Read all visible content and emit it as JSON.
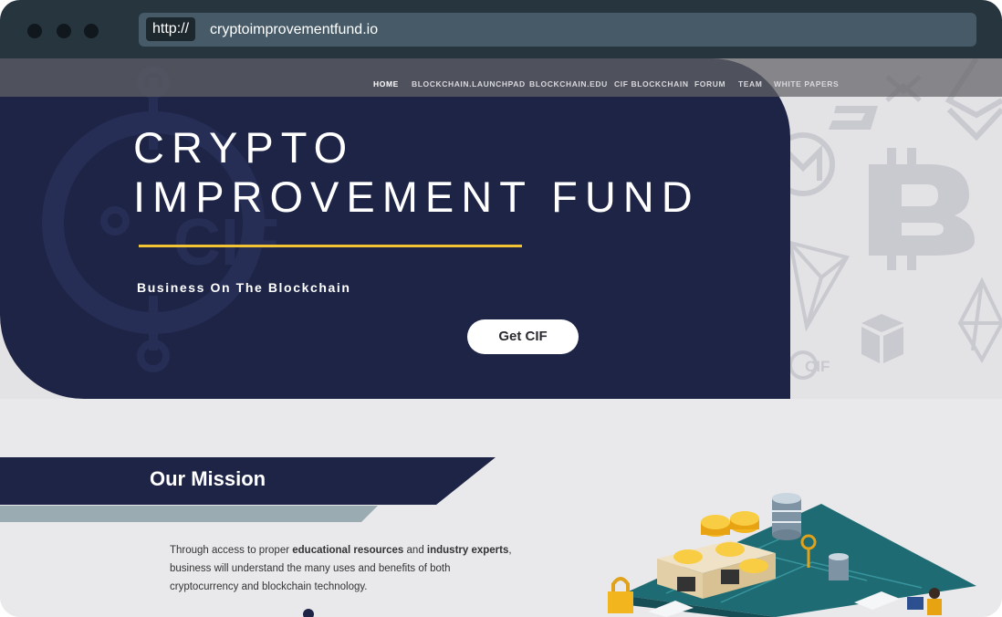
{
  "browser": {
    "protocol": "http://",
    "url": "cryptoimprovementfund.io"
  },
  "nav": {
    "items": [
      {
        "label": "HOME",
        "active": true
      },
      {
        "label": "BLOCKCHAIN.LAUNCHPAD",
        "active": false
      },
      {
        "label": "BLOCKCHAIN.EDU",
        "active": false
      },
      {
        "label": "CIF BLOCKCHAIN",
        "active": false
      },
      {
        "label": "FORUM",
        "active": false
      },
      {
        "label": "TEAM",
        "active": false
      },
      {
        "label": "WHITE PAPERS",
        "active": false
      }
    ]
  },
  "hero": {
    "title_line1": "CRYPTO",
    "title_line2": "IMPROVEMENT FUND",
    "tagline": "Business On The Blockchain",
    "cta_label": "Get CIF",
    "watermark_logo_text": "CIF",
    "small_logo_text": "CIF"
  },
  "mission": {
    "title": "Our Mission",
    "text_part1": "Through access to proper ",
    "text_bold1": "educational resources",
    "text_part2": " and ",
    "text_bold2": "industry experts",
    "text_part3": ", business will understand the many uses and benefits of both cryptocurrency and blockchain technology."
  },
  "colors": {
    "hero_navy": "#1e2446",
    "accent_yellow": "#f2c434",
    "browser_chrome": "#27353f",
    "url_bar": "#465a67"
  }
}
